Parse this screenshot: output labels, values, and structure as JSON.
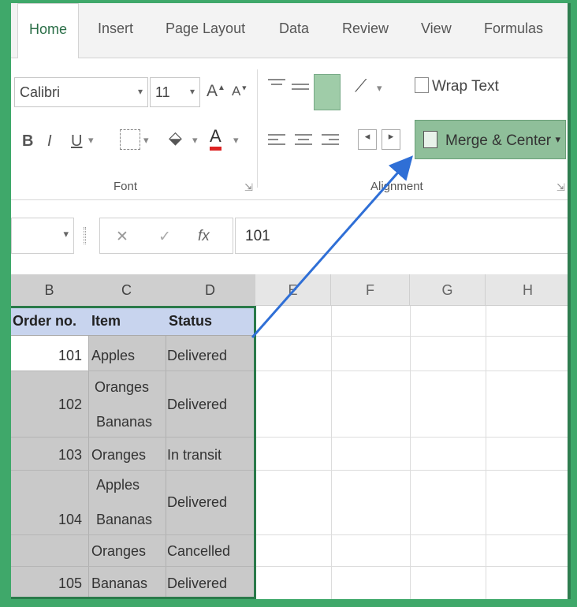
{
  "ribbon": {
    "tabs": [
      "Home",
      "Insert",
      "Page Layout",
      "Data",
      "Review",
      "View",
      "Formulas"
    ],
    "font_name": "Calibri",
    "font_size": "11",
    "grow_font": "A",
    "shrink_font": "A",
    "bold": "B",
    "italic": "I",
    "underline": "U",
    "wrap_text": "Wrap Text",
    "merge_center": "Merge & Center",
    "group_font": "Font",
    "group_alignment": "Alignment"
  },
  "formula_bar": {
    "cancel": "✕",
    "enter": "✓",
    "fx": "fx",
    "value": "101"
  },
  "sheet": {
    "columns": [
      "B",
      "C",
      "D",
      "E",
      "F",
      "G",
      "H"
    ],
    "headers": {
      "order": "Order no.",
      "item": "Item",
      "status": "Status"
    },
    "rows": [
      {
        "order": "101",
        "item": "Apples",
        "status": "Delivered"
      },
      {
        "order": "102",
        "item_line1": "Oranges",
        "item_line2": "Bananas",
        "status": "Delivered"
      },
      {
        "order": "103",
        "item": "Oranges",
        "status": "In transit"
      },
      {
        "order": "104",
        "item_line1": "Apples",
        "item_line2": "Bananas",
        "status": "Delivered"
      },
      {
        "order": "",
        "item": "Oranges",
        "status": "Cancelled"
      },
      {
        "order": "105",
        "item": "Bananas",
        "status": "Delivered"
      }
    ]
  },
  "colors": {
    "accent": "#2a7a4a",
    "arrow": "#2f6fd6",
    "merge_button": "#8fbf9a",
    "header_fill": "#c8d4ee"
  }
}
